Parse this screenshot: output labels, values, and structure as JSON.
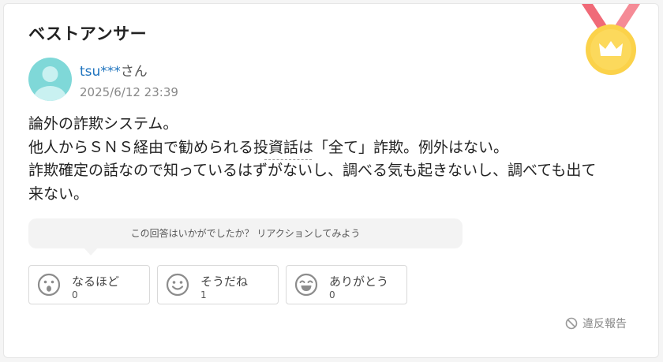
{
  "header": {
    "title": "ベストアンサー"
  },
  "answer": {
    "user_name": "tsu***",
    "user_suffix": "さん",
    "date": "2025/6/12 23:39",
    "lines": [
      "論外の詐欺システム。",
      "他人からＳＮＳ経由で勧められる投資話は「全て」詐欺。例外はない。",
      "詐欺確定の話なので知っているはずがないし、調べる気も起きないし、調べても出て",
      "来ない。"
    ]
  },
  "reactions": {
    "prompt": "この回答はいかがでしたか？ リアクションしてみよう",
    "items": [
      {
        "label": "なるほど",
        "count": "0",
        "icon": "surprised-face-icon"
      },
      {
        "label": "そうだね",
        "count": "1",
        "icon": "smile-face-icon"
      },
      {
        "label": "ありがとう",
        "count": "0",
        "icon": "grin-face-icon"
      }
    ]
  },
  "footer": {
    "report_label": "違反報告"
  },
  "colors": {
    "accent": "#1e73be",
    "medal_ribbon": "#f06a78",
    "medal_gold": "#fbd24a",
    "avatar": "#7fd8d8"
  }
}
